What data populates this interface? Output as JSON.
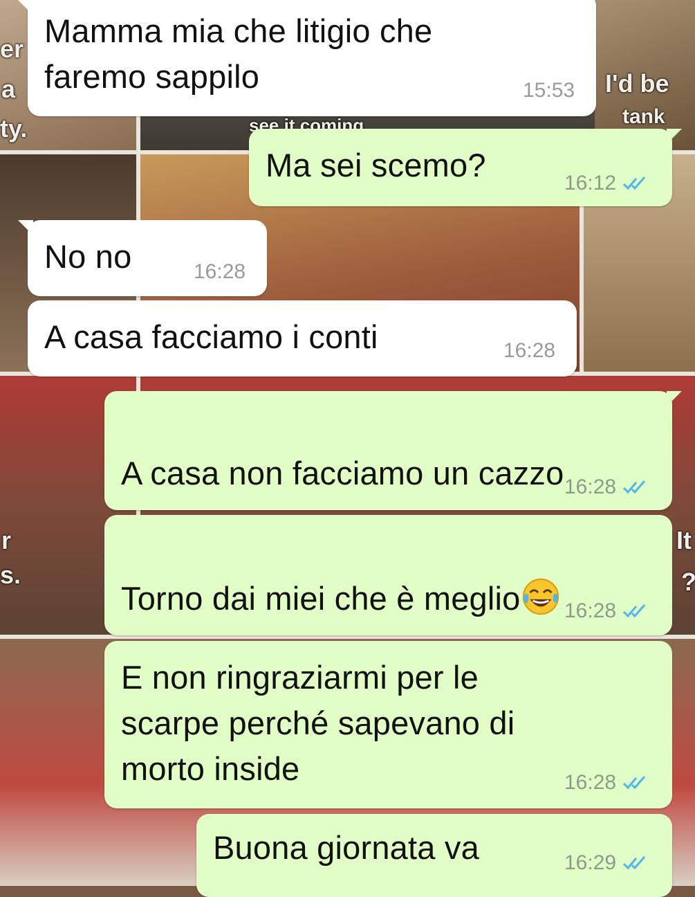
{
  "wallpaper": {
    "captions": {
      "c1": "er",
      "c2": "a",
      "c3": "ty.",
      "c4": "I'd be",
      "c5": "tank",
      "c6": "see it coming",
      "c7": "r",
      "c8": "s.",
      "c9": "It",
      "c10": "?"
    }
  },
  "messages": [
    {
      "dir": "in",
      "text": "Mamma mia che litigio che\nfaremo sappilo",
      "time": "15:53"
    },
    {
      "dir": "out",
      "text": "Ma sei scemo?",
      "time": "16:12"
    },
    {
      "dir": "in",
      "text": "No no",
      "time": "16:28"
    },
    {
      "dir": "in",
      "text": "A casa facciamo i conti",
      "time": "16:28"
    },
    {
      "dir": "out",
      "text": "A casa non facciamo un cazzo",
      "time": "16:28"
    },
    {
      "dir": "out",
      "text": "Torno dai miei che è meglio",
      "time": "16:28"
    },
    {
      "dir": "out",
      "text": "E non ringraziarmi per le\nscarpe perché sapevano di\nmorto inside",
      "time": "16:28"
    },
    {
      "dir": "out",
      "text": "Buona giornata va",
      "time": "16:29"
    }
  ],
  "emoji": {
    "name": "face-with-tears-of-joy-icon"
  },
  "colors": {
    "incoming_bubble": "#ffffff",
    "outgoing_bubble": "#e1fec6",
    "read_tick": "#4fb6ec"
  }
}
